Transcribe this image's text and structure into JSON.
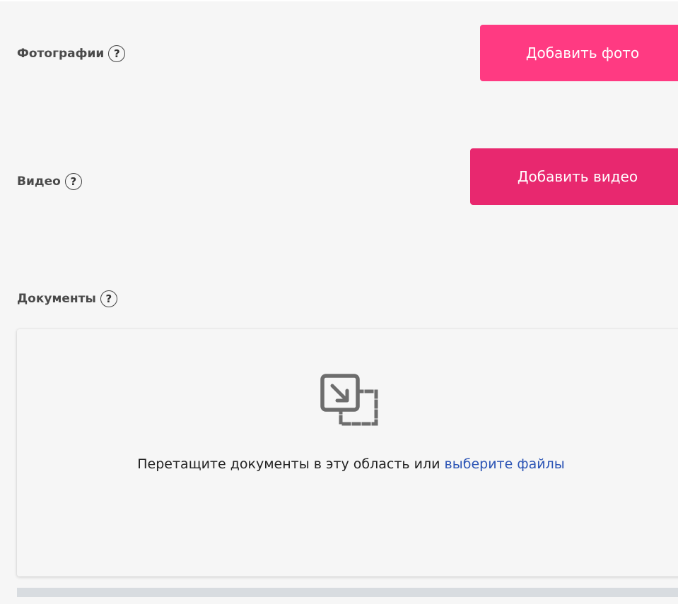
{
  "photos": {
    "label": "Фотографии",
    "help": "?",
    "button_label": "Добавить фото"
  },
  "video": {
    "label": "Видео",
    "help": "?",
    "button_label": "Добавить видео"
  },
  "documents": {
    "label": "Документы",
    "help": "?",
    "dropzone_text": "Перетащите документы в эту область или",
    "dropzone_link": "выберите файлы",
    "dropzone_icon": "drag-drop-file-icon"
  },
  "colors": {
    "photo_button": "#ff3a82",
    "video_button": "#e8286f",
    "link": "#2b54b5",
    "background": "#f6f6f6"
  }
}
